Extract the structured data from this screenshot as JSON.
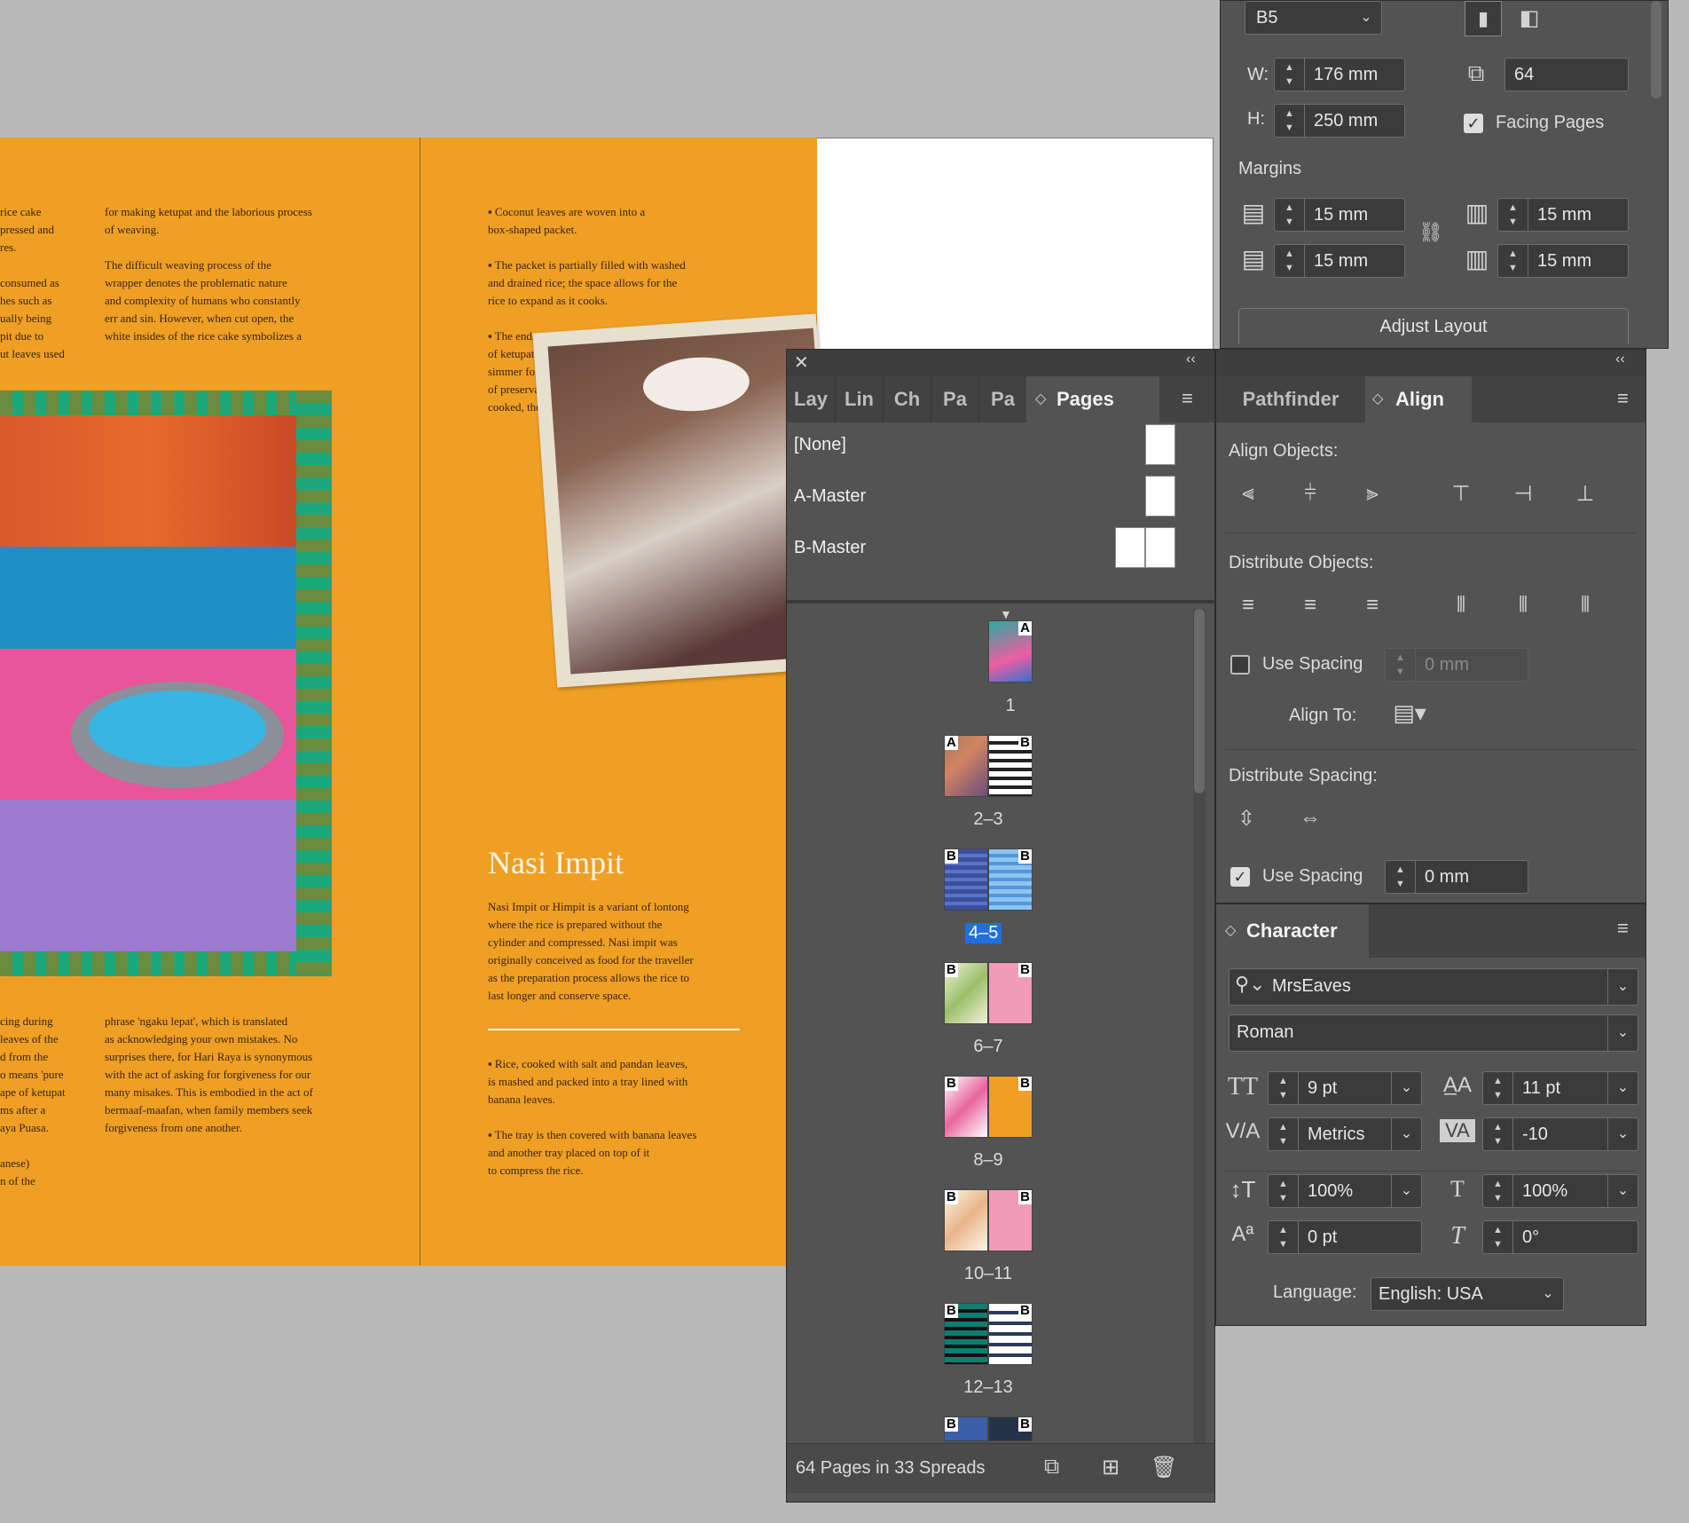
{
  "document": {
    "left_col1": "rice cake\npressed and\nres.\n\nconsumed as\nhes such as\nually being\npit due to\nut leaves used",
    "left_col2": "for making ketupat and the laborious process\nof weaving.\n\nThe difficult weaving process of the\nwrapper denotes the problematic nature\nand complexity of humans who constantly\nerr and sin. However, when cut open, the\nwhite insides of the rice cake symbolizes a",
    "left_bottom1": "cing during\nleaves of the\nd from the\no means 'pure\nape of ketupat\nms after a\naya Puasa.\n\nanese)\nn of the",
    "left_bottom2": "phrase 'ngaku lepat', which is translated\nas acknowledging your own mistakes. No\nsurprises there, for Hari Raya is synonymous\nwith the act of asking for forgiveness for our\nmany misakes. This is embodied in the act of\nbermaaf-maafan, when family members seek\nforgiveness from one another.",
    "right_steps": "▪ Coconut leaves are woven into a\nbox-shaped packet.\n\n▪ The packet is partially filled with washed\nand drained rice; the space allows for the\nrice to expand as it cooks.\n\n▪ The ends are sealed and the bundles\nof ketupat are immersed in boiling water to\nsimmer for hours. This serves as a method\nof preservation  -the longer the ketupat is\ncooked, the longer it can be kept.",
    "heading": "Nasi Impit",
    "intro": "Nasi Impit or Himpit is a variant of lontong\nwhere the rice is prepared without the\ncylinder and compressed. Nasi impit was\noriginally conceived as food for the traveller\nas the preparation process allows the rice to\nlast longer and conserve space.",
    "steps2": "▪ Rice, cooked with salt and pandan leaves,\nis mashed and packed into a tray lined with\nbanana leaves.\n\n▪ The tray is then covered with banana leaves\nand another tray placed on top of it\nto compress the rice."
  },
  "doc_setup": {
    "preset": "B5",
    "width_label": "W:",
    "width": "176 mm",
    "height_label": "H:",
    "height": "250 mm",
    "pages": "64",
    "facing_pages_label": "Facing Pages",
    "margins_label": "Margins",
    "margin_top": "15 mm",
    "margin_bottom": "15 mm",
    "margin_inside": "15 mm",
    "margin_outside": "15 mm",
    "adjust_button": "Adjust Layout"
  },
  "pages_panel": {
    "tabs": [
      "Lay",
      "Lin",
      "Ch",
      "Pa",
      "Pa",
      "Pages"
    ],
    "masters": [
      "[None]",
      "A-Master",
      "B-Master"
    ],
    "spreads": [
      {
        "label": "1",
        "master": "A"
      },
      {
        "label": "2–3",
        "master": "A B"
      },
      {
        "label": "4–5",
        "master": "B B",
        "selected": true
      },
      {
        "label": "6–7",
        "master": "B B"
      },
      {
        "label": "8–9",
        "master": "B B"
      },
      {
        "label": "10–11",
        "master": "B B"
      },
      {
        "label": "12–13",
        "master": "B B"
      }
    ],
    "footer": "64 Pages in 33 Spreads"
  },
  "align_panel": {
    "tabs": [
      "Pathfinder",
      "Align"
    ],
    "align_objects": "Align Objects:",
    "distribute_objects": "Distribute Objects:",
    "use_spacing_1": "Use Spacing",
    "spacing_1": "0 mm",
    "align_to": "Align To:",
    "distribute_spacing": "Distribute Spacing:",
    "use_spacing_2": "Use Spacing",
    "spacing_2": "0 mm"
  },
  "character_panel": {
    "title": "Character",
    "font": "MrsEaves",
    "style": "Roman",
    "size": "9 pt",
    "leading": "11 pt",
    "kerning": "Metrics",
    "tracking": "-10",
    "vscale": "100%",
    "hscale": "100%",
    "baseline": "0 pt",
    "skew": "0°",
    "language_label": "Language:",
    "language": "English: USA"
  },
  "colors": {
    "page_orange": "#ef9f24",
    "panel_bg": "#535353",
    "selection_blue": "#1f6fe0"
  }
}
